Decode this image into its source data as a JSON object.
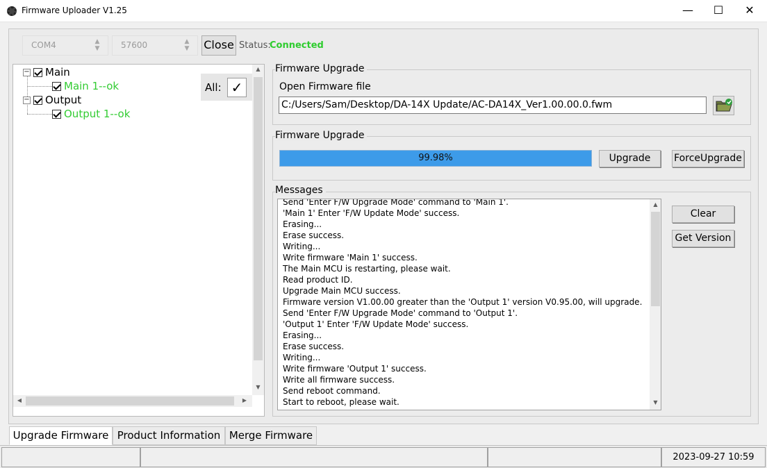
{
  "window": {
    "title": "Firmware Uploader V1.25",
    "minimize": "—",
    "maximize": "☐",
    "close": "✕"
  },
  "connection": {
    "port_value": "COM4",
    "baud_value": "57600",
    "close_label": "Close",
    "status_label": "Status:",
    "status_value": "Connected",
    "status_color": "#2ecc2e"
  },
  "tree": {
    "all_label": "All:",
    "nodes": [
      {
        "label": "Main",
        "children": [
          {
            "label": "Main 1--ok"
          }
        ]
      },
      {
        "label": "Output",
        "children": [
          {
            "label": "Output 1--ok"
          }
        ]
      }
    ],
    "ok_color": "#33cc33"
  },
  "firmware_file": {
    "group_title": "Firmware Upgrade",
    "open_label": "Open Firmware file",
    "path": "C:/Users/Sam/Desktop/DA-14X Update/AC-DA14X_Ver1.00.00.0.fwm"
  },
  "upgrade": {
    "group_title": "Firmware Upgrade",
    "progress_text": "99.98%",
    "progress_value": 0.9998,
    "upgrade_label": "Upgrade",
    "force_label": "ForceUpgrade"
  },
  "messages": {
    "group_title": "Messages",
    "lines": [
      "Send 'Enter F/W Upgrade Mode' command to 'Main 1'.",
      "'Main 1' Enter 'F/W Update Mode' success.",
      "Erasing...",
      "Erase success.",
      "Writing...",
      "Write firmware 'Main 1' success.",
      "The Main MCU is restarting, please wait.",
      "Read product ID.",
      "Upgrade Main MCU success.",
      "Firmware version V1.00.00 greater than the 'Output 1' version V0.95.00, will upgrade.",
      "Send 'Enter F/W Upgrade Mode' command to 'Output 1'.",
      "'Output 1' Enter 'F/W Update Mode' success.",
      "Erasing...",
      "Erase success.",
      "Writing...",
      "Write firmware 'Output 1' success.",
      "Write all firmware success.",
      "Send reboot command.",
      "Start to reboot, please wait."
    ],
    "clear_label": "Clear",
    "get_version_label": "Get Version"
  },
  "tabs": [
    {
      "label": "Upgrade Firmware",
      "active": true
    },
    {
      "label": "Product Information",
      "active": false
    },
    {
      "label": "Merge Firmware",
      "active": false
    }
  ],
  "statusbar": {
    "datetime": "2023-09-27 10:59"
  }
}
